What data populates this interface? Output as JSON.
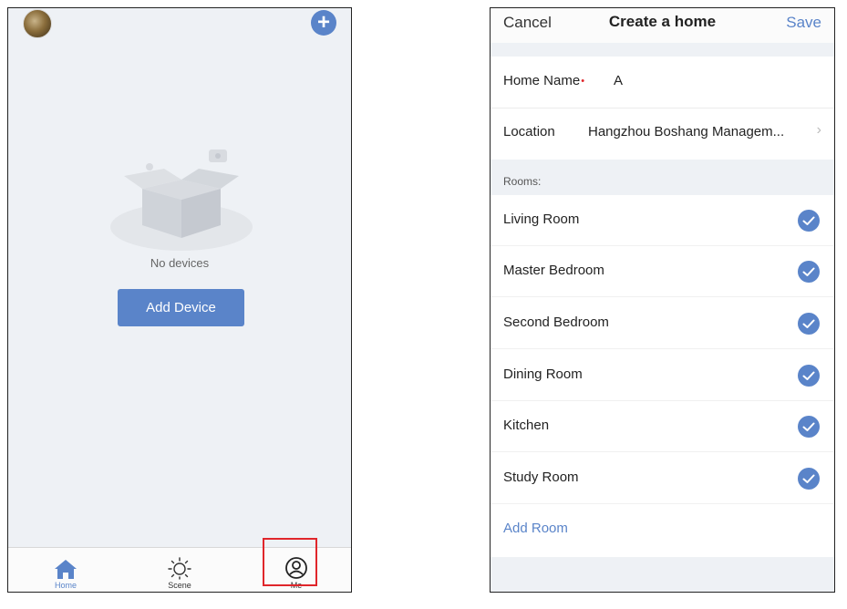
{
  "home_screen": {
    "empty_text": "No devices",
    "add_device_label": "Add Device",
    "tabs": [
      {
        "label": "Home",
        "icon": "home-icon",
        "active": true
      },
      {
        "label": "Scene",
        "icon": "sun-icon",
        "active": false
      },
      {
        "label": "Me",
        "icon": "user-circle-icon",
        "active": false
      }
    ]
  },
  "create_home": {
    "cancel_label": "Cancel",
    "title": "Create a home",
    "save_label": "Save",
    "home_name_label": "Home Name",
    "required_marker": "•",
    "home_name_value": "A",
    "location_label": "Location",
    "location_value": "Hangzhou Boshang Managem...",
    "rooms_header": "Rooms:",
    "rooms": [
      {
        "name": "Living Room",
        "checked": true
      },
      {
        "name": "Master Bedroom",
        "checked": true
      },
      {
        "name": "Second Bedroom",
        "checked": true
      },
      {
        "name": "Dining Room",
        "checked": true
      },
      {
        "name": "Kitchen",
        "checked": true
      },
      {
        "name": "Study Room",
        "checked": true
      }
    ],
    "add_room_label": "Add Room"
  },
  "colors": {
    "accent": "#5a84c9",
    "highlight": "#e0262b",
    "background": "#eef1f5"
  }
}
